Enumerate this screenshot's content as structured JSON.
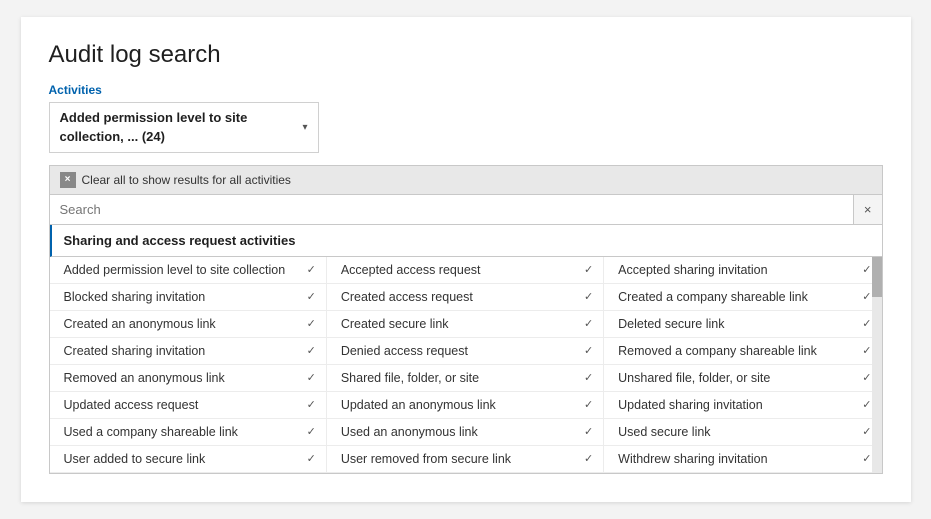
{
  "page": {
    "title": "Audit log search",
    "activities_label": "Activities",
    "dropdown_text": "Added permission level to site collection, ... (24)",
    "clear_label": "Clear all to show results for all activities",
    "search_placeholder": "Search",
    "category_header": "Sharing and access request activities"
  },
  "activities": [
    [
      "Added permission level to site collection",
      "Accepted access request",
      "Accepted sharing invitation"
    ],
    [
      "Blocked sharing invitation",
      "Created access request",
      "Created a company shareable link"
    ],
    [
      "Created an anonymous link",
      "Created secure link",
      "Deleted secure link"
    ],
    [
      "Created sharing invitation",
      "Denied access request",
      "Removed a company shareable link"
    ],
    [
      "Removed an anonymous link",
      "Shared file, folder, or site",
      "Unshared file, folder, or site"
    ],
    [
      "Updated access request",
      "Updated an anonymous link",
      "Updated sharing invitation"
    ],
    [
      "Used a company shareable link",
      "Used an anonymous link",
      "Used secure link"
    ],
    [
      "User added to secure link",
      "User removed from secure link",
      "Withdrew sharing invitation"
    ]
  ],
  "icons": {
    "clear_x": "×",
    "checkmark": "✓",
    "arrow_down": "▾",
    "search_clear": "×"
  }
}
